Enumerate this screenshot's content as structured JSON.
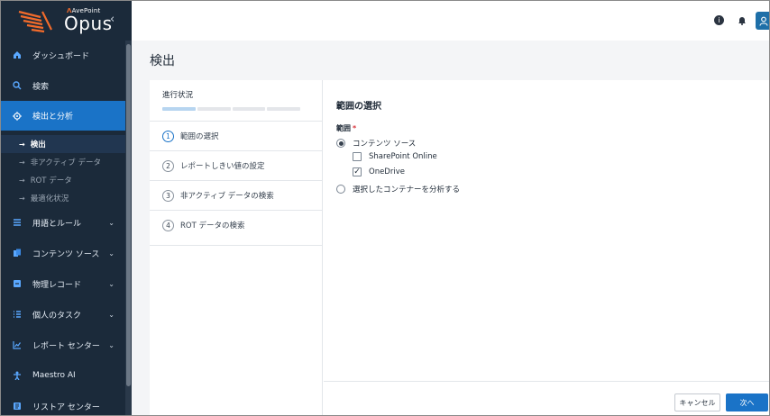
{
  "brand": {
    "company": "AvePoint",
    "product": "Opus"
  },
  "sidebar": {
    "items": [
      {
        "label": "ダッシュボード",
        "icon": "home-icon"
      },
      {
        "label": "検索",
        "icon": "search-icon"
      },
      {
        "label": "検出と分析",
        "icon": "target-icon",
        "active": true
      },
      {
        "label": "用語とルール",
        "icon": "list-icon"
      },
      {
        "label": "コンテンツ ソース",
        "icon": "files-icon"
      },
      {
        "label": "物理レコード",
        "icon": "archive-icon"
      },
      {
        "label": "個人のタスク",
        "icon": "tasks-icon"
      },
      {
        "label": "レポート センター",
        "icon": "chart-icon"
      },
      {
        "label": "Maestro AI",
        "icon": "ai-icon"
      },
      {
        "label": "リストア センター",
        "icon": "restore-icon"
      }
    ],
    "subitems": [
      {
        "label": "検出",
        "active": true
      },
      {
        "label": "非アクティブ データ"
      },
      {
        "label": "ROT データ"
      },
      {
        "label": "最適化状況"
      }
    ]
  },
  "page": {
    "title": "検出"
  },
  "wizard": {
    "progress_label": "進行状況",
    "progress_current": 1,
    "progress_total": 4,
    "steps": [
      {
        "num": "1",
        "label": "範囲の選択"
      },
      {
        "num": "2",
        "label": "レポートしきい値の設定"
      },
      {
        "num": "3",
        "label": "非アクティブ データの検索"
      },
      {
        "num": "4",
        "label": "ROT データの検索"
      }
    ]
  },
  "form": {
    "title": "範囲の選択",
    "scope_label": "範囲",
    "required_mark": "*",
    "option_content_source": "コンテンツ ソース",
    "option_sharepoint": "SharePoint Online",
    "option_onedrive": "OneDrive",
    "option_containers": "選択したコンテナーを分析する",
    "check_mark": "✓"
  },
  "footer": {
    "cancel": "キャンセル",
    "next": "次へ"
  },
  "colors": {
    "accent": "#1a73c7",
    "sidebar": "#1b2a3a",
    "brand_orange": "#f26b2b"
  }
}
